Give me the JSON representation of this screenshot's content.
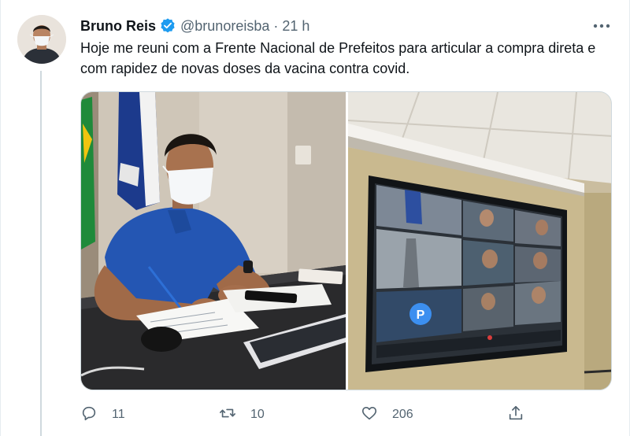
{
  "tweet": {
    "author_name": "Bruno Reis",
    "handle": "@brunoreisba",
    "separator": "·",
    "time": "21 h",
    "text": "Hoje me reuni com a Frente Nacional de Prefeitos para articular a compra direta e com rapidez de novas doses da vacina contra covid."
  },
  "actions": {
    "replies": "11",
    "retweets": "10",
    "likes": "206"
  },
  "icons": {
    "verified": "verified-badge-icon",
    "more": "more-options-icon",
    "reply": "reply-icon",
    "retweet": "retweet-icon",
    "like": "heart-icon",
    "share": "share-icon"
  },
  "colors": {
    "verified": "#1d9bf0",
    "secondary_text": "#536471",
    "divider": "#cfd9de"
  }
}
